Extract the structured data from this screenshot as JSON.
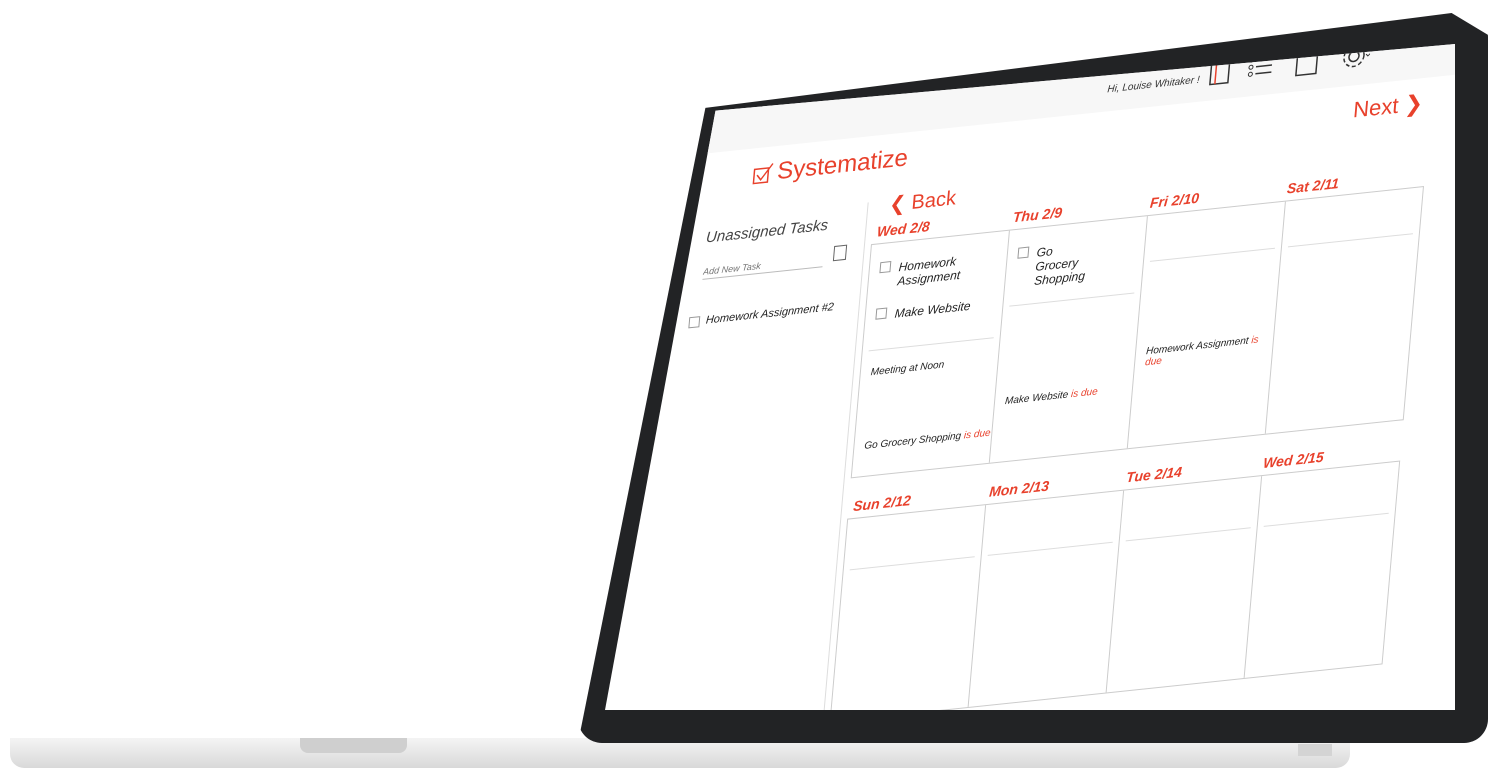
{
  "header": {
    "greeting": "Hi, Louise Whitaker !",
    "brand": "Systematize",
    "next_label": "Next"
  },
  "icons": {
    "notebook": "notebook-icon",
    "list": "list-icon",
    "note": "note-icon",
    "settings": "gear-icon"
  },
  "sidebar": {
    "title": "Unassigned Tasks",
    "add_placeholder": "Add New Task",
    "tasks": [
      {
        "label": "Homework Assignment #2"
      }
    ]
  },
  "calendar": {
    "back_label": "Back",
    "week1": [
      {
        "day": "Wed 2/8",
        "tasks": [
          "Homework Assignment",
          "Make Website"
        ],
        "events": [
          "Meeting at Noon"
        ],
        "due": [
          {
            "name": "Go Grocery Shopping",
            "suffix": "is due"
          }
        ]
      },
      {
        "day": "Thu 2/9",
        "tasks": [
          "Go Grocery Shopping"
        ],
        "events": [],
        "due": [
          {
            "name": "Make Website",
            "suffix": "is due"
          }
        ]
      },
      {
        "day": "Fri 2/10",
        "tasks": [],
        "events": [],
        "due": [
          {
            "name": "Homework Assignment",
            "suffix": "is due"
          }
        ]
      },
      {
        "day": "Sat 2/11",
        "tasks": [],
        "events": [],
        "due": []
      }
    ],
    "week2": [
      {
        "day": "Sun 2/12"
      },
      {
        "day": "Mon 2/13"
      },
      {
        "day": "Tue 2/14"
      },
      {
        "day": "Wed 2/15"
      }
    ]
  },
  "colors": {
    "accent": "#e8412c",
    "bezel": "#222325"
  }
}
